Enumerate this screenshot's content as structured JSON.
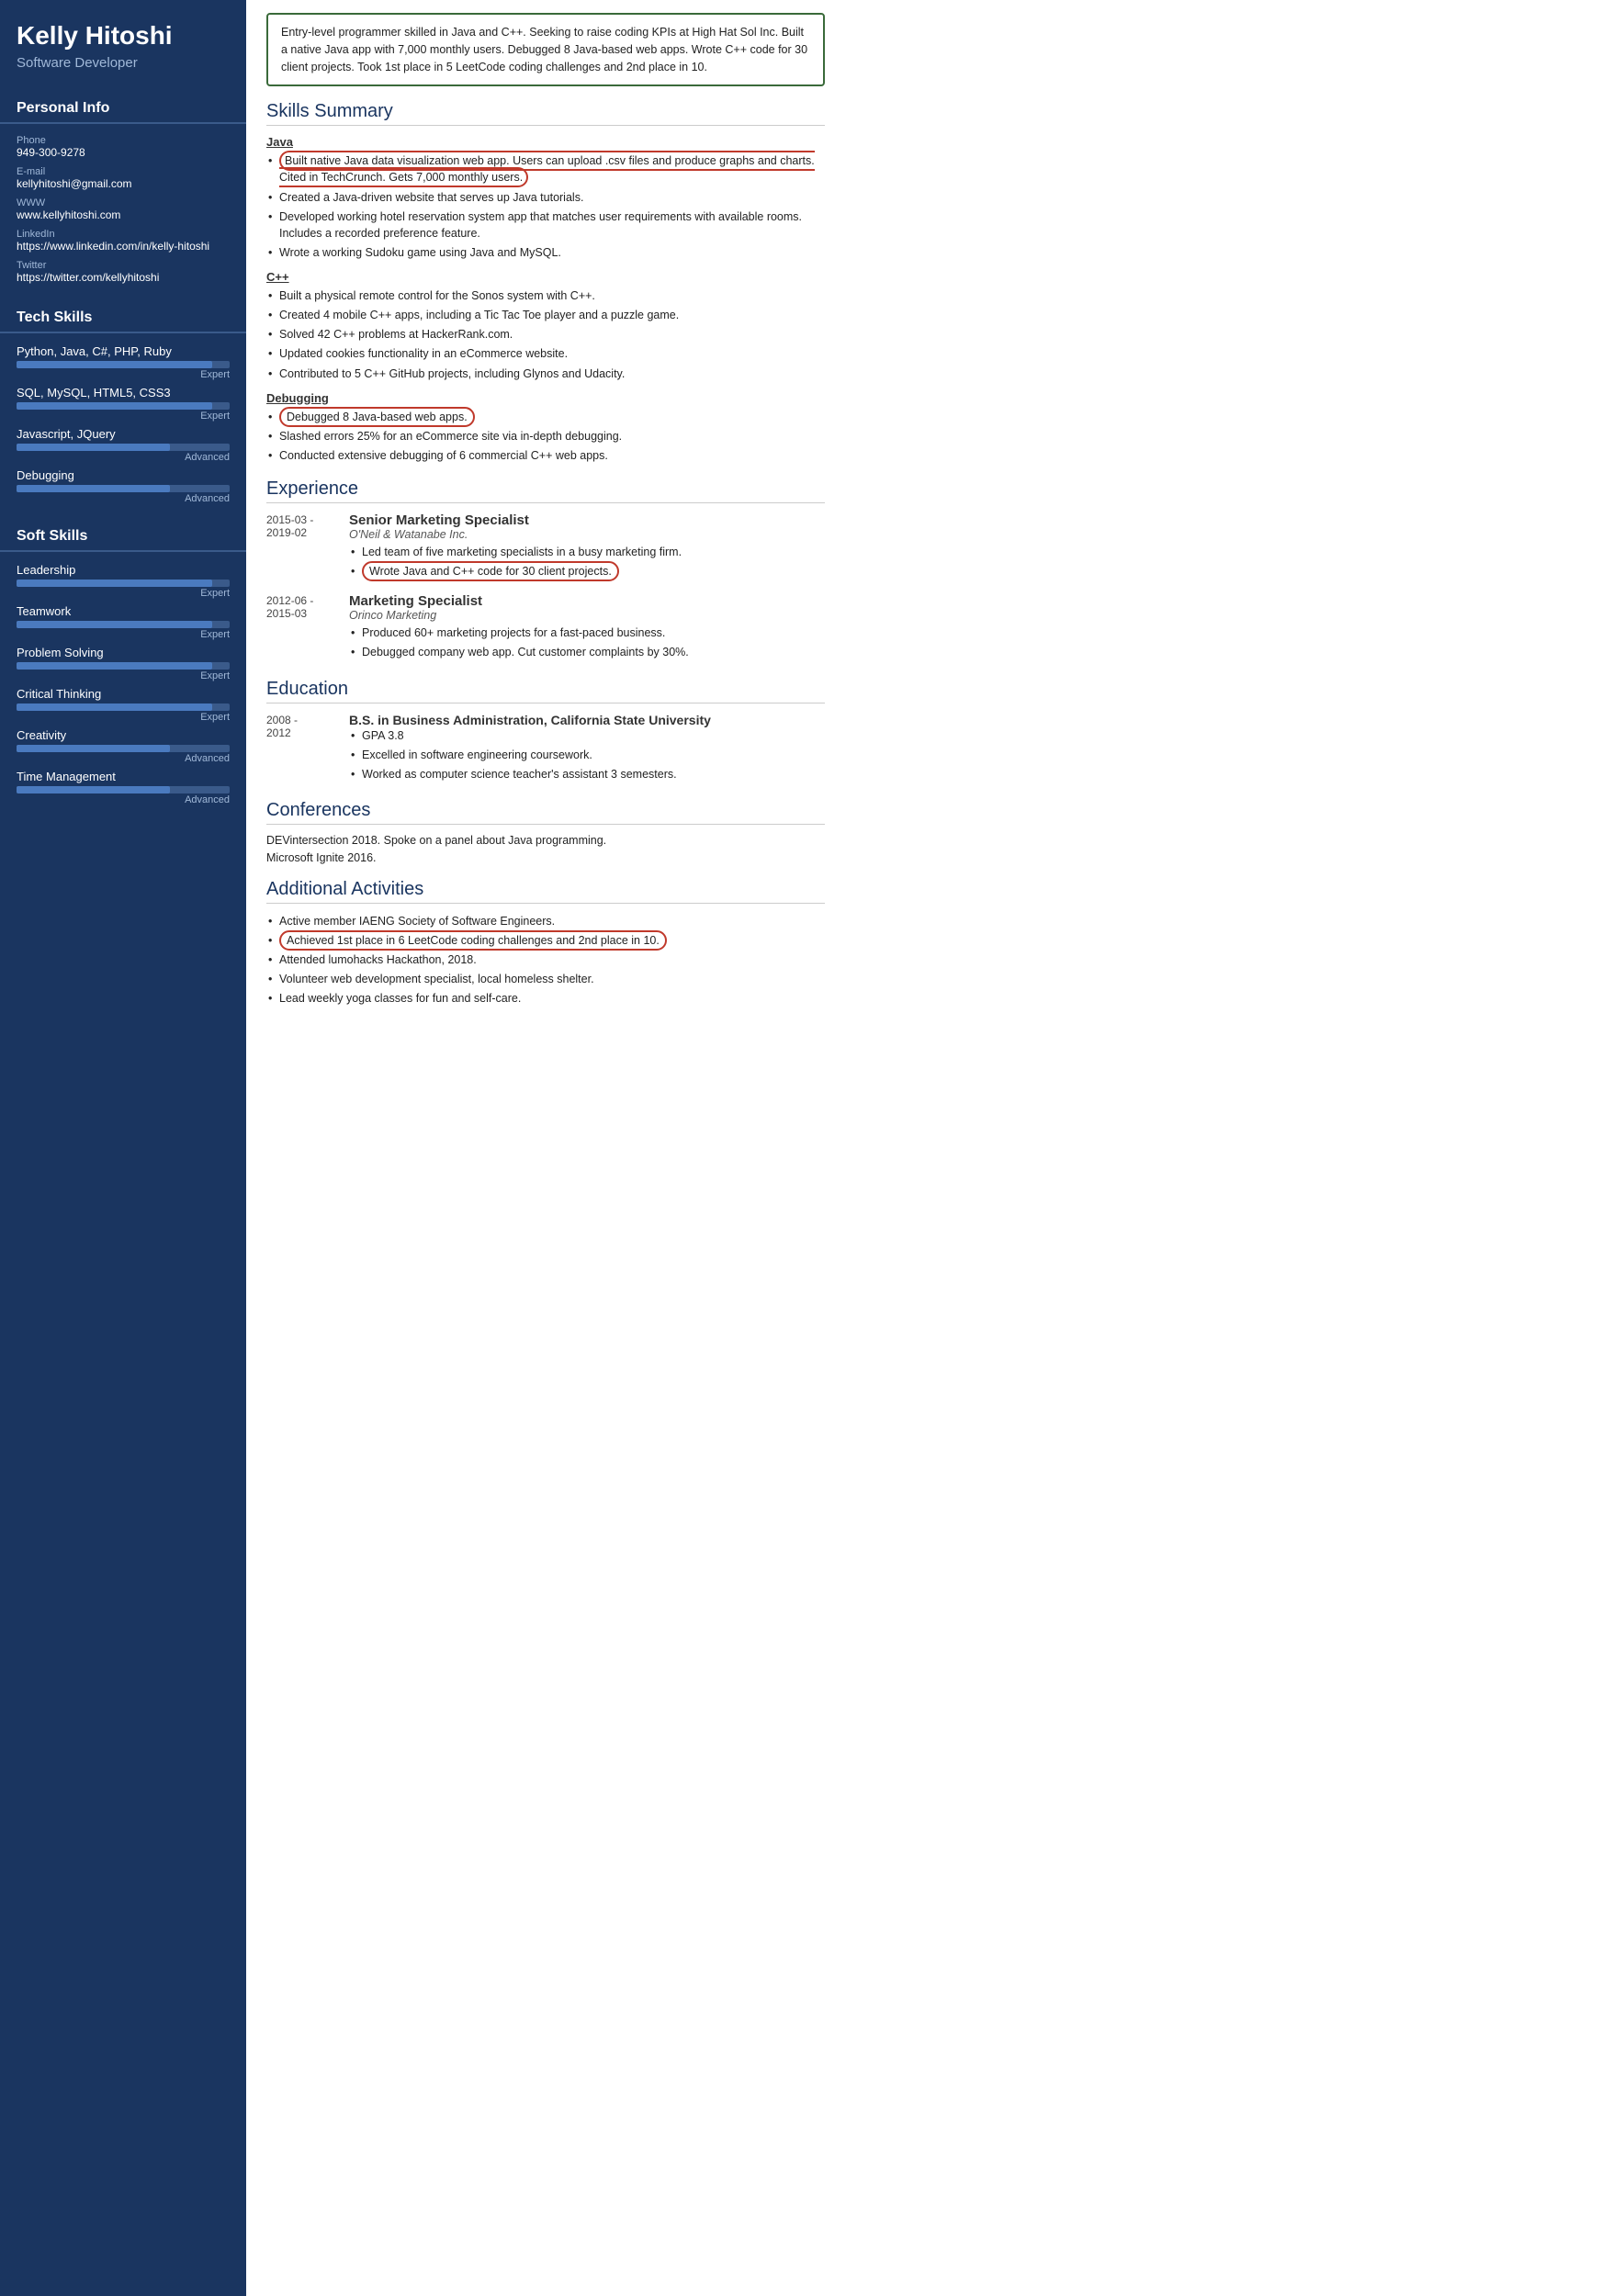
{
  "sidebar": {
    "name": "Kelly Hitoshi",
    "title": "Software Developer",
    "sections": {
      "personal_info_title": "Personal Info",
      "personal": [
        {
          "label": "Phone",
          "value": "949-300-9278"
        },
        {
          "label": "E-mail",
          "value": "kellyhitoshi@gmail.com"
        },
        {
          "label": "WWW",
          "value": "www.kellyhitoshi.com"
        },
        {
          "label": "LinkedIn",
          "value": "https://www.linkedin.com/in/kelly-hitoshi"
        },
        {
          "label": "Twitter",
          "value": "https://twitter.com/kellyhitoshi"
        }
      ],
      "tech_skills_title": "Tech Skills",
      "tech_skills": [
        {
          "name": "Python, Java, C#, PHP, Ruby",
          "fill": 92,
          "level": "Expert"
        },
        {
          "name": "SQL, MySQL, HTML5, CSS3",
          "fill": 92,
          "level": "Expert"
        },
        {
          "name": "Javascript, JQuery",
          "fill": 72,
          "level": "Advanced"
        },
        {
          "name": "Debugging",
          "fill": 72,
          "level": "Advanced"
        }
      ],
      "soft_skills_title": "Soft Skills",
      "soft_skills": [
        {
          "name": "Leadership",
          "fill": 92,
          "level": "Expert"
        },
        {
          "name": "Teamwork",
          "fill": 92,
          "level": "Expert"
        },
        {
          "name": "Problem Solving",
          "fill": 92,
          "level": "Expert"
        },
        {
          "name": "Critical Thinking",
          "fill": 92,
          "level": "Expert"
        },
        {
          "name": "Creativity",
          "fill": 72,
          "level": "Advanced"
        },
        {
          "name": "Time Management",
          "fill": 72,
          "level": "Advanced"
        }
      ]
    }
  },
  "main": {
    "summary": "Entry-level programmer skilled in Java and C++. Seeking to raise coding KPIs at High Hat Sol Inc. Built a native Java app with 7,000 monthly users. Debugged 8 Java-based web apps. Wrote C++ code for 30 client projects. Took 1st place in 5 LeetCode coding challenges and 2nd place in 10.",
    "skills_summary_title": "Skills Summary",
    "java_title": "Java",
    "java_bullets": [
      {
        "text": "Built native Java data visualization web app. Users can upload .csv files and produce graphs and charts. Cited in TechCrunch. Gets 7,000 monthly users.",
        "highlight": true
      },
      {
        "text": "Created a Java-driven website that serves up Java tutorials.",
        "highlight": false
      },
      {
        "text": "Developed working hotel reservation system app that matches user requirements with available rooms. Includes a recorded preference feature.",
        "highlight": false
      },
      {
        "text": "Wrote a working Sudoku game using Java and MySQL.",
        "highlight": false
      }
    ],
    "cpp_title": "C++",
    "cpp_bullets": [
      "Built a physical remote control for the Sonos system with C++.",
      "Created 4 mobile C++ apps, including a Tic Tac Toe player and a puzzle game.",
      "Solved 42 C++ problems at HackerRank.com.",
      "Updated cookies functionality in an eCommerce website.",
      "Contributed to 5 C++ GitHub projects, including Glynos and Udacity."
    ],
    "debugging_title": "Debugging",
    "debugging_bullets": [
      {
        "text": "Debugged 8 Java-based web apps.",
        "highlight": true
      },
      {
        "text": "Slashed errors 25% for an eCommerce site via in-depth debugging.",
        "highlight": false
      },
      {
        "text": "Conducted extensive debugging of 6 commercial C++ web apps.",
        "highlight": false
      }
    ],
    "experience_title": "Experience",
    "experience": [
      {
        "dates": "2015-03 - 2019-02",
        "title": "Senior Marketing Specialist",
        "company": "O'Neil & Watanabe Inc.",
        "bullets": [
          {
            "text": "Led team of five marketing specialists in a busy marketing firm.",
            "highlight": false
          },
          {
            "text": "Wrote Java and C++ code for 30 client projects.",
            "highlight": true
          }
        ]
      },
      {
        "dates": "2012-06 - 2015-03",
        "title": "Marketing Specialist",
        "company": "Orinco Marketing",
        "bullets": [
          {
            "text": "Produced 60+ marketing projects for a fast-paced business.",
            "highlight": false
          },
          {
            "text": "Debugged company web app. Cut customer complaints by 30%.",
            "highlight": false
          }
        ]
      }
    ],
    "education_title": "Education",
    "education": [
      {
        "dates": "2008 - 2012",
        "title": "B.S. in Business Administration, California State University",
        "bullets": [
          "GPA 3.8",
          "Excelled in software engineering coursework.",
          "Worked as computer science teacher's assistant 3 semesters."
        ]
      }
    ],
    "conferences_title": "Conferences",
    "conferences": [
      "DEVintersection 2018. Spoke on a panel about Java programming.",
      "Microsoft Ignite 2016."
    ],
    "additional_title": "Additional Activities",
    "additional_bullets": [
      {
        "text": "Active member IAENG Society of Software Engineers.",
        "highlight": false
      },
      {
        "text": "Achieved 1st place in 6 LeetCode coding challenges and 2nd place in 10.",
        "highlight": true
      },
      {
        "text": "Attended lumohacks Hackathon, 2018.",
        "highlight": false
      },
      {
        "text": "Volunteer web development specialist, local homeless shelter.",
        "highlight": false
      },
      {
        "text": "Lead weekly yoga classes for fun and self-care.",
        "highlight": false
      }
    ]
  }
}
